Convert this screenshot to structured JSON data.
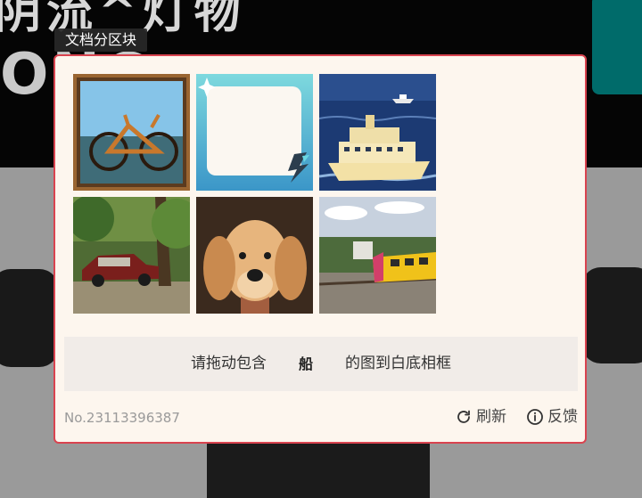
{
  "background": {
    "headline_text": "阴流^灯物",
    "subline_text": "ONC",
    "accent_color": "#006b6a"
  },
  "section": {
    "label": "文档分区块"
  },
  "captcha": {
    "border_color": "#d9434f",
    "images": [
      {
        "icon": "bicycle-painting"
      },
      {
        "icon": "blank-drop-frame"
      },
      {
        "icon": "ferry-boat-painting"
      },
      {
        "icon": "car-painting"
      },
      {
        "icon": "dog-painting"
      },
      {
        "icon": "train-painting"
      }
    ],
    "instruction_prefix": "请拖动包含",
    "instruction_target": "船",
    "instruction_suffix": "的图到白底相框",
    "serial": "No.23113396387",
    "refresh_label": "刷新",
    "feedback_label": "反馈"
  }
}
